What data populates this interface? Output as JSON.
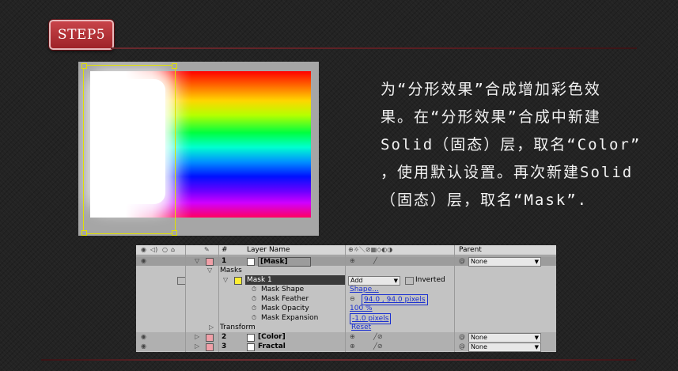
{
  "step_badge": "STEP5",
  "description": {
    "lines": [
      "为“分形效果”合成增加彩色效",
      "果。在“分形效果”合成中新建",
      "Solid（固态）层，取名“Color”",
      "，使用默认设置。再次新建Solid",
      "（固态）层，取名“Mask”."
    ]
  },
  "timeline": {
    "header": {
      "number": "#",
      "layer_name": "Layer Name",
      "parent": "Parent"
    },
    "layers": [
      {
        "index": "1",
        "name": "[Mask]",
        "parent": "None",
        "color": "#f0a0a8"
      },
      {
        "index": "2",
        "name": "[Color]",
        "parent": "None",
        "color": "#f0a0a8"
      },
      {
        "index": "3",
        "name": "Fractal",
        "parent": "None",
        "color": "#f0a0a8"
      }
    ],
    "masks_group": "Masks",
    "mask": {
      "name": "Mask 1",
      "mode": "Add",
      "inverted_label": "Inverted",
      "color": "#ffee33"
    },
    "mask_props": [
      {
        "label": "Mask Shape",
        "value": "Shape..."
      },
      {
        "label": "Mask Feather",
        "value": "94.0 , 94.0 pixels"
      },
      {
        "label": "Mask Opacity",
        "value": "100 %"
      },
      {
        "label": "Mask Expansion",
        "value": "-1.0 pixels"
      }
    ],
    "transform": {
      "label": "Transform",
      "value": "Reset"
    }
  },
  "colors": {
    "badge_red": "#b02a30",
    "accent_rule": "#6a2a2e"
  },
  "icons": [
    "eye-icon",
    "audio-icon",
    "solo-icon",
    "lock-icon",
    "label-icon",
    "switches-icon",
    "parent-spiral-icon"
  ]
}
